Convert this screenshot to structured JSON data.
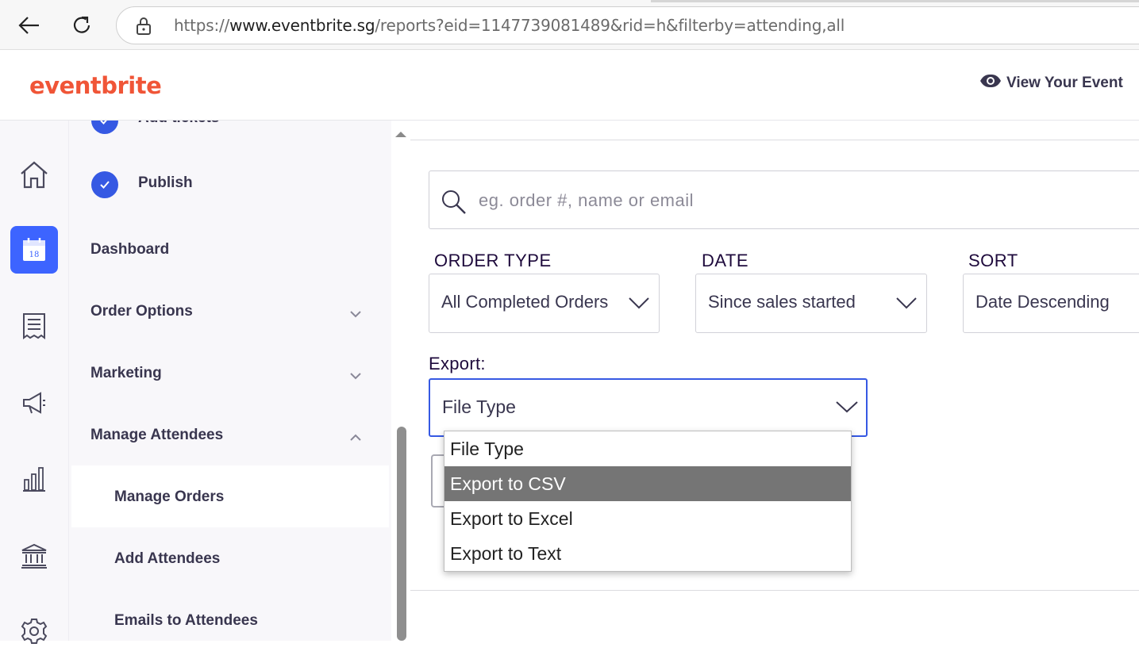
{
  "browser": {
    "url_prefix": "https://",
    "url_domain": "www.eventbrite.sg",
    "url_path": "/reports?eid=1147739081489&rid=h&filterby=attending,all"
  },
  "header": {
    "logo": "eventbrite",
    "view_event": "View Your Event"
  },
  "sidebar": {
    "add_tickets": "Add tickets",
    "publish": "Publish",
    "dashboard": "Dashboard",
    "order_options": "Order Options",
    "marketing": "Marketing",
    "manage_attendees": "Manage Attendees",
    "manage_orders": "Manage Orders",
    "add_attendees": "Add Attendees",
    "emails_to_attendees": "Emails to Attendees",
    "calendar_day": "18"
  },
  "search": {
    "placeholder": "eg. order #, name or email"
  },
  "filters": {
    "order_type": {
      "label": "ORDER TYPE",
      "value": "All Completed Orders"
    },
    "date": {
      "label": "DATE",
      "value": "Since sales started"
    },
    "sort": {
      "label": "SORT",
      "value": "Date Descending"
    }
  },
  "export": {
    "label": "Export:",
    "value": "File Type",
    "options": [
      "File Type",
      "Export to CSV",
      "Export to Excel",
      "Export to Text"
    ],
    "highlighted": "Export to CSV"
  },
  "colors": {
    "brand": "#f05537",
    "accent": "#3659e3",
    "highlight": "#757575"
  }
}
